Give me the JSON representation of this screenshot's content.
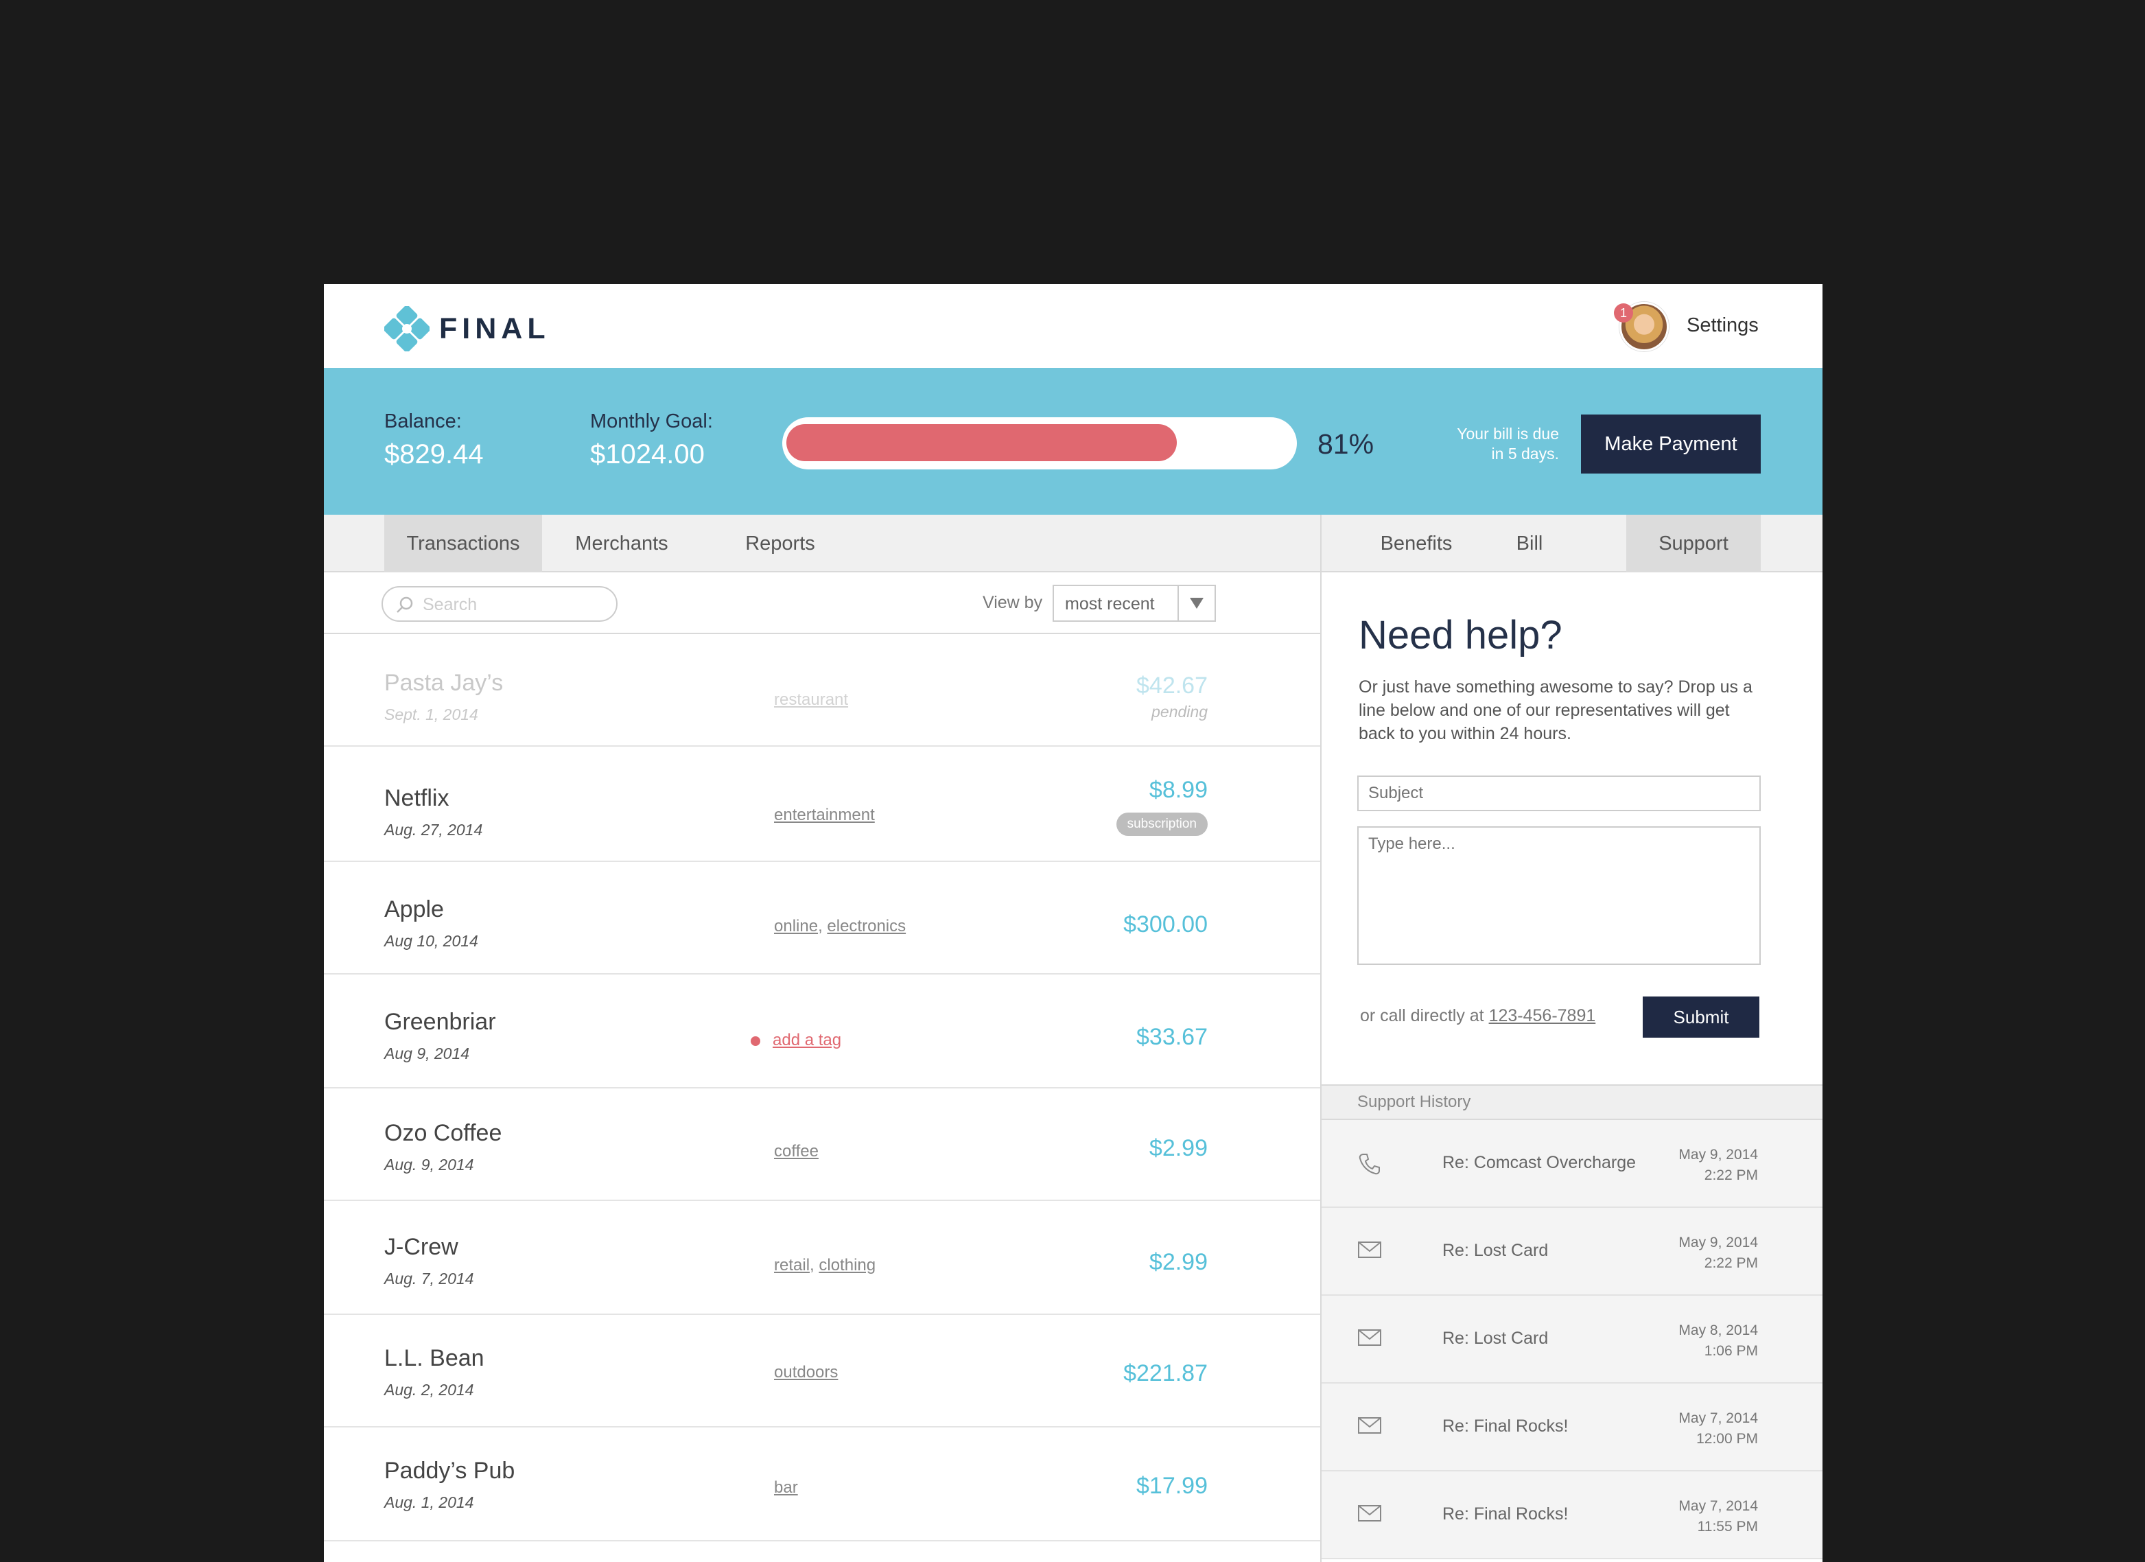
{
  "app": {
    "logo_text": "FINAL"
  },
  "header": {
    "notification_count": "1",
    "settings_label": "Settings"
  },
  "balance": {
    "balance_label": "Balance:",
    "balance_value": "$829.44",
    "goal_label": "Monthly Goal:",
    "goal_value": "$1024.00",
    "progress_percent": 81,
    "progress_label": "81%",
    "due_text": "Your bill is due in 5 days.",
    "pay_label": "Make Payment"
  },
  "tabs_left": [
    {
      "label": "Transactions"
    },
    {
      "label": "Merchants"
    },
    {
      "label": "Reports"
    }
  ],
  "tabs_right": [
    {
      "label": "Benefits"
    },
    {
      "label": "Bill"
    },
    {
      "label": "Support"
    }
  ],
  "toolbar": {
    "search_placeholder": "Search",
    "view_by_label": "View by",
    "view_by_value": "most recent"
  },
  "transactions": [
    {
      "name": "Pasta Jay’s",
      "date": "Sept. 1, 2014",
      "tags": [
        "restaurant"
      ],
      "amount": "$42.67",
      "note": "pending"
    },
    {
      "name": "Netflix",
      "date": "Aug. 27, 2014",
      "tags": [
        "entertainment"
      ],
      "amount": "$8.99",
      "badge": "subscription"
    },
    {
      "name": "Apple",
      "date": "Aug 10, 2014",
      "tags": [
        "online",
        "electronics"
      ],
      "amount": "$300.00"
    },
    {
      "name": "Greenbriar",
      "date": "Aug 9, 2014",
      "tags": [
        "add a tag"
      ],
      "amount": "$33.67"
    },
    {
      "name": "Ozo Coffee",
      "date": "Aug. 9, 2014",
      "tags": [
        "coffee"
      ],
      "amount": "$2.99"
    },
    {
      "name": "J-Crew",
      "date": "Aug. 7, 2014",
      "tags": [
        "retail",
        "clothing"
      ],
      "amount": "$2.99"
    },
    {
      "name": "L.L. Bean",
      "date": "Aug. 2, 2014",
      "tags": [
        "outdoors"
      ],
      "amount": "$221.87"
    },
    {
      "name": "Paddy’s Pub",
      "date": "Aug. 1, 2014",
      "tags": [
        "bar"
      ],
      "amount": "$17.99"
    }
  ],
  "support": {
    "title": "Need help?",
    "text": "Or just have something awesome to say? Drop us a line below and one of our representatives will get back to you within 24 hours.",
    "subject_placeholder": "Subject",
    "message_placeholder": "Type here...",
    "call_text": "or call directly at",
    "phone": "123-456-7891",
    "submit_label": "Submit",
    "history_label": "Support History",
    "history": [
      {
        "icon": "phone-icon",
        "subject": "Re: Comcast Overcharge",
        "date": "May 9, 2014",
        "time": "2:22 PM"
      },
      {
        "icon": "mail-icon",
        "subject": "Re: Lost Card",
        "date": "May 9, 2014",
        "time": "2:22 PM"
      },
      {
        "icon": "mail-icon",
        "subject": "Re: Lost Card",
        "date": "May 8, 2014",
        "time": "1:06 PM"
      },
      {
        "icon": "mail-icon",
        "subject": "Re: Final Rocks!",
        "date": "May 7, 2014",
        "time": "12:00 PM"
      },
      {
        "icon": "mail-icon",
        "subject": "Re: Final Rocks!",
        "date": "May 7, 2014",
        "time": "11:55 PM"
      }
    ]
  },
  "colors": {
    "accent": "#72c6db",
    "progress": "#e06870",
    "navy": "#1f2944",
    "amount": "#56c0d9"
  }
}
